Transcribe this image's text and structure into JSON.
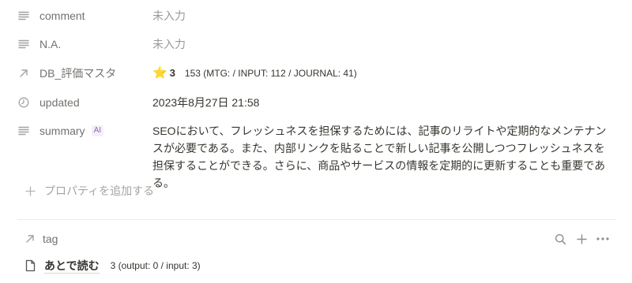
{
  "properties": {
    "comment": {
      "label": "comment",
      "icon": "text-lines-icon",
      "value": "未入力"
    },
    "na": {
      "label": "N.A.",
      "icon": "text-lines-icon",
      "value": "未入力"
    },
    "db": {
      "label": "DB_評価マスタ",
      "icon": "relation-arrow-icon",
      "star": "⭐",
      "count": "3",
      "detail": "153 (MTG: / INPUT: 112 / JOURNAL: 41)"
    },
    "updated": {
      "label": "updated",
      "icon": "clock-icon",
      "value": "2023年8月27日 21:58"
    },
    "summary": {
      "label": "summary",
      "badge": "AI",
      "icon": "text-lines-icon",
      "value": "SEOにおいて、フレッシュネスを担保するためには、記事のリライトや定期的なメンテナンスが必要である。また、内部リンクを貼ることで新しい記事を公開しつつフレッシュネスを担保することができる。さらに、商品やサービスの情報を定期的に更新することも重要である。"
    }
  },
  "add_property_label": "プロパティを追加する",
  "tag_section": {
    "title": "tag",
    "item": {
      "label": "あとで読む",
      "count": "3 (output: 0 / input: 3)"
    }
  },
  "colors": {
    "text": "#37352f",
    "muted": "#73726e",
    "placeholder": "#9b9a97",
    "ai_badge": "#9065b0"
  }
}
